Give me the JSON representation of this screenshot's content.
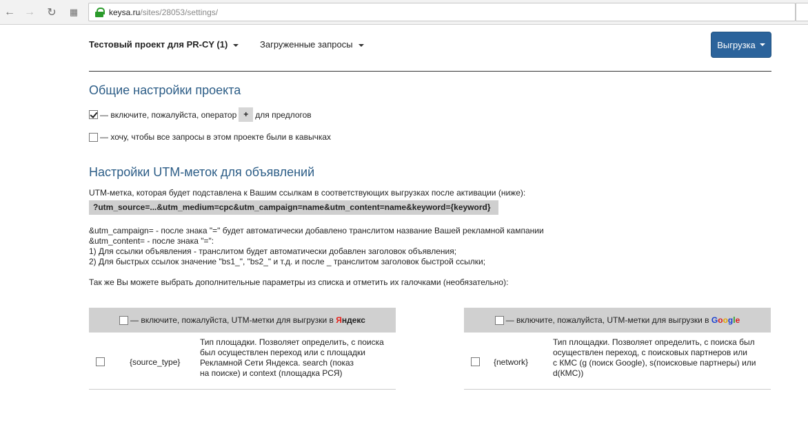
{
  "browser": {
    "url_host": "keysa.ru",
    "url_path": "/sites/28053/settings/"
  },
  "topbar": {
    "project_label": "Тестовый проект для PR-CY (1)",
    "loaded_queries_label": "Загруженные запросы",
    "export_label": "Выгрузка"
  },
  "general": {
    "title": "Общие настройки проекта",
    "option_plus_before": "— включите, пожалуйста, оператор",
    "option_plus_badge": "+",
    "option_plus_after": "для предлогов",
    "option_plus_checked": true,
    "option_quotes": "— хочу, чтобы все запросы в этом проекте были в кавычках",
    "option_quotes_checked": false
  },
  "utm": {
    "title": "Настройки UTM-меток для объявлений",
    "description": "UTM-метка, которая будет подставлена к Вашим ссылкам в соответствующих выгрузках после активации (ниже):",
    "code": "?utm_source=...&utm_medium=cpc&utm_campaign=name&utm_content=name&keyword={keyword}",
    "notes": [
      "&utm_campaign= - после знака \"=\" будет автоматически добавлено транслитом название Вашей рекламной кампании",
      "&utm_content= - после знака \"=\":",
      "1) Для ссылки объявления - транслитом будет автоматически добавлен заголовок объявления;",
      "2) Для быстрых ссылок значение \"bs1_\", \"bs2_\" и т.д. и после _ транслитом заголовок быстрой ссылки;"
    ],
    "extra": "Так же Вы можете выбрать дополнительные параметры из списка и отметить их галочками (необязательно):"
  },
  "yandex_panel": {
    "header_text": "— включите, пожалуйста, UTM-метки для выгрузки в",
    "brand_first": "Я",
    "brand_rest": "ндекс",
    "row_param": "{source_type}",
    "row_desc": [
      "Тип площадки. Позволяет определить, с поиска",
      "был осуществлен переход или с площадки",
      "Рекламной Сети Яндекса. search (показ",
      "на поиске) и context (площадка РСЯ)"
    ]
  },
  "google_panel": {
    "header_text": "— включите, пожалуйста, UTM-метки для выгрузки в",
    "brand_letters": [
      {
        "ch": "G",
        "color": "#1a3fd0"
      },
      {
        "ch": "o",
        "color": "#d81e1e"
      },
      {
        "ch": "o",
        "color": "#e6a500"
      },
      {
        "ch": "g",
        "color": "#1a3fd0"
      },
      {
        "ch": "l",
        "color": "#2a9a2a"
      },
      {
        "ch": "e",
        "color": "#d81e1e"
      }
    ],
    "row_param": "{network}",
    "row_desc": [
      "Тип площадки. Позволяет определить, с поиска был",
      "осуществлен переход, с поисковых партнеров или",
      "с КМС (g (поиск Google), s(поисковые партнеры) или",
      "d(КМС))"
    ]
  },
  "colors": {
    "accent": "#2b639b",
    "heading": "#2b5c86"
  }
}
